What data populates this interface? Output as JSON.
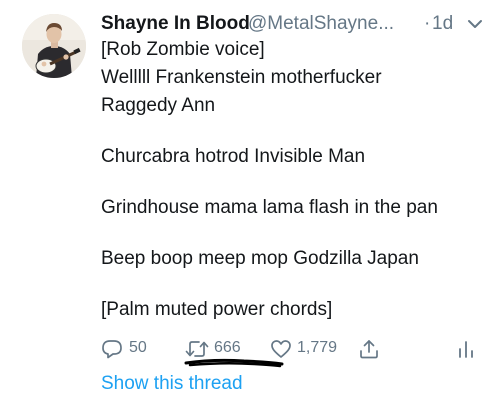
{
  "tweet": {
    "author_name": "Shayne In Blood",
    "handle": "@MetalShayne...",
    "separator": "·",
    "time": "1d",
    "lines": [
      "[Rob Zombie voice]",
      "Welllll Frankenstein motherfucker",
      "Raggedy Ann",
      "Churcabra hotrod Invisible Man",
      "Grindhouse mama lama flash in the pan",
      "Beep boop meep mop Godzilla Japan",
      "[Palm muted power chords]"
    ],
    "actions": {
      "reply_count": "50",
      "retweet_count": "666",
      "like_count": "1,779"
    },
    "show_thread": "Show this thread",
    "icons": {
      "more": "chevron-down-icon",
      "reply": "reply-icon",
      "retweet": "retweet-icon",
      "like": "heart-icon",
      "share": "share-icon",
      "analytics": "analytics-icon"
    },
    "colors": {
      "text": "#14171a",
      "secondary": "#657786",
      "link": "#1da1f2"
    }
  }
}
